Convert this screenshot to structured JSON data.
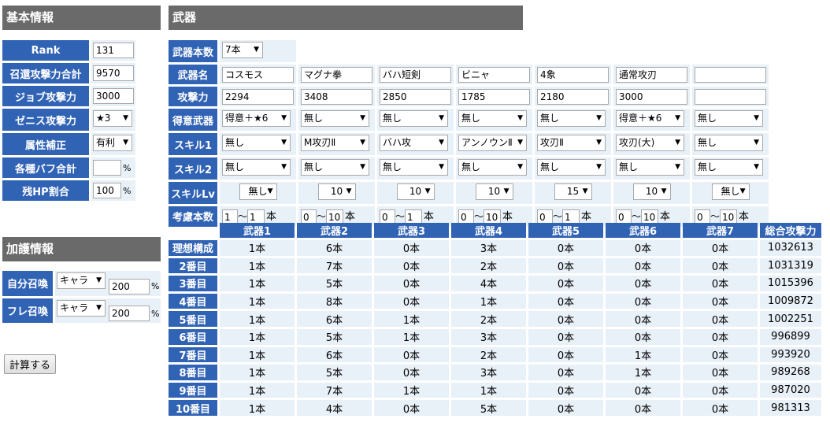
{
  "basic": {
    "title": "基本情報",
    "rows": [
      {
        "label": "Rank",
        "value": "131",
        "kind": "input"
      },
      {
        "label": "召還攻撃力合計",
        "value": "9570",
        "kind": "input"
      },
      {
        "label": "ジョブ攻撃力",
        "value": "3000",
        "kind": "input"
      },
      {
        "label": "ゼニス攻撃力",
        "value": "★3",
        "kind": "select"
      },
      {
        "label": "属性補正",
        "value": "有利",
        "kind": "select"
      },
      {
        "label": "各種バフ合計",
        "value": "",
        "kind": "input",
        "unit": "%"
      },
      {
        "label": "残HP割合",
        "value": "100",
        "kind": "input",
        "unit": "%"
      }
    ]
  },
  "protection": {
    "title": "加護情報",
    "rows": [
      {
        "label": "自分召喚",
        "select": "キャラ",
        "value": "200",
        "unit": "%"
      },
      {
        "label": "フレ召喚",
        "select": "キャラ",
        "value": "200",
        "unit": "%"
      }
    ]
  },
  "calc_button": "計算する",
  "weapons": {
    "title": "武器",
    "count_label": "武器本数",
    "count_value": "7本",
    "labels": {
      "name": "武器名",
      "atk": "攻撃力",
      "fav": "得意武器",
      "skill1": "スキル1",
      "skill2": "スキル2",
      "skill_lv": "スキルLv",
      "consider": "考慮本数"
    },
    "names": [
      "コスモス",
      "マグナ拳",
      "バハ短剣",
      "ビニャ",
      "4象",
      "通常攻刃",
      ""
    ],
    "atk": [
      "2294",
      "3408",
      "2850",
      "1785",
      "2180",
      "3000",
      ""
    ],
    "fav": [
      "得意＋★6",
      "無し",
      "無し",
      "無し",
      "無し",
      "得意＋★6",
      "無し"
    ],
    "skill1": [
      "無し",
      "M攻刃Ⅱ",
      "バハ攻",
      "アンノウンⅡ",
      "攻刃Ⅱ",
      "攻刃(大)",
      "無し"
    ],
    "skill2": [
      "無し",
      "無し",
      "無し",
      "無し",
      "無し",
      "無し",
      "無し"
    ],
    "skill_lv": [
      "無し",
      "10",
      "10",
      "10",
      "15",
      "10",
      "無し"
    ],
    "consider_min": [
      "1",
      "0",
      "0",
      "0",
      "0",
      "0",
      "0"
    ],
    "consider_max": [
      "1",
      "10",
      "1",
      "10",
      "1",
      "10",
      "10"
    ],
    "tilde": "～",
    "hon": "本"
  },
  "results": {
    "headers": [
      "",
      "武器1",
      "武器2",
      "武器3",
      "武器4",
      "武器5",
      "武器6",
      "武器7",
      "総合攻撃力"
    ],
    "rows": [
      [
        "理想構成",
        "1本",
        "6本",
        "0本",
        "3本",
        "0本",
        "0本",
        "0本",
        "1032613"
      ],
      [
        "2番目",
        "1本",
        "7本",
        "0本",
        "2本",
        "0本",
        "0本",
        "0本",
        "1031319"
      ],
      [
        "3番目",
        "1本",
        "5本",
        "0本",
        "4本",
        "0本",
        "0本",
        "0本",
        "1015396"
      ],
      [
        "4番目",
        "1本",
        "8本",
        "0本",
        "1本",
        "0本",
        "0本",
        "0本",
        "1009872"
      ],
      [
        "5番目",
        "1本",
        "6本",
        "1本",
        "2本",
        "0本",
        "0本",
        "0本",
        "1002251"
      ],
      [
        "6番目",
        "1本",
        "5本",
        "1本",
        "3本",
        "0本",
        "0本",
        "0本",
        "996899"
      ],
      [
        "7番目",
        "1本",
        "6本",
        "0本",
        "2本",
        "0本",
        "1本",
        "0本",
        "993920"
      ],
      [
        "8番目",
        "1本",
        "5本",
        "0本",
        "3本",
        "0本",
        "1本",
        "0本",
        "989268"
      ],
      [
        "9番目",
        "1本",
        "7本",
        "1本",
        "1本",
        "0本",
        "0本",
        "0本",
        "987020"
      ],
      [
        "10番目",
        "1本",
        "4本",
        "0本",
        "5本",
        "0本",
        "0本",
        "0本",
        "981313"
      ]
    ]
  }
}
